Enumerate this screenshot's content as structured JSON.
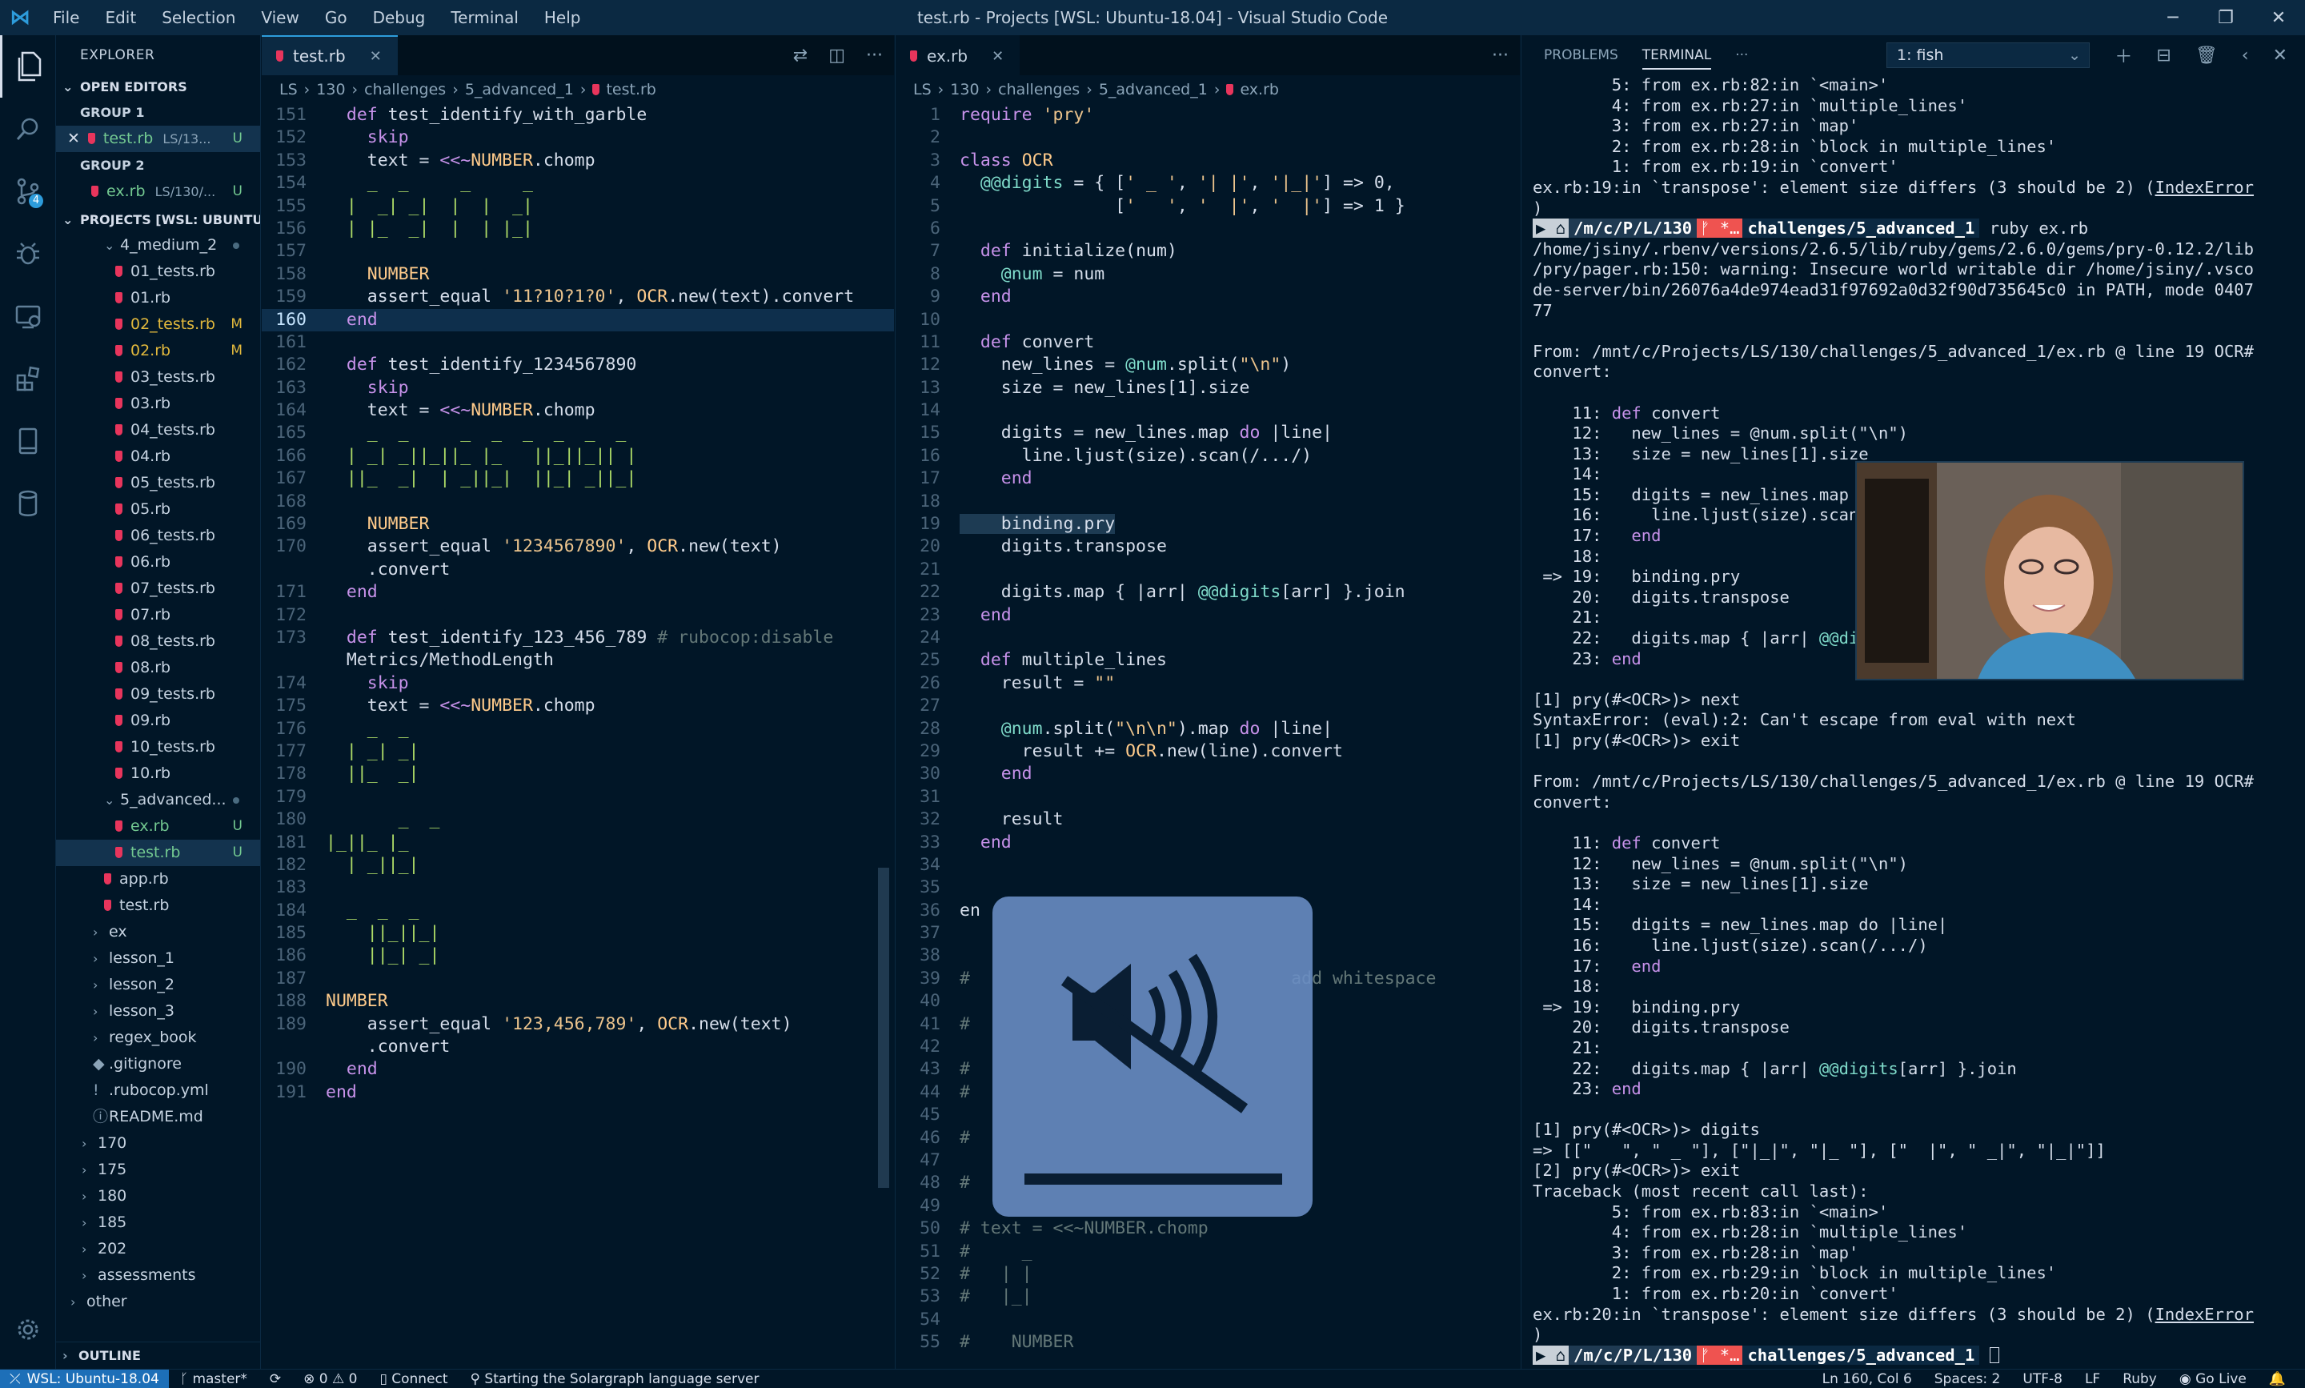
{
  "window": {
    "title": "test.rb - Projects [WSL: Ubuntu-18.04] - Visual Studio Code",
    "menu": [
      "File",
      "Edit",
      "Selection",
      "View",
      "Go",
      "Debug",
      "Terminal",
      "Help"
    ]
  },
  "activity": {
    "scm_badge": "4"
  },
  "sidebar": {
    "title": "EXPLORER",
    "open_editors_label": "OPEN EDITORS",
    "group1_label": "GROUP 1",
    "group1_file": "test.rb",
    "group1_path": "LS/13...",
    "group1_status": "U",
    "group2_label": "GROUP 2",
    "group2_file": "ex.rb",
    "group2_path": "LS/130/...",
    "group2_status": "U",
    "projects_label": "PROJECTS [WSL: UBUNTU-...",
    "tree": [
      {
        "name": "4_medium_2",
        "type": "folder-open",
        "indent": 2,
        "dot": true
      },
      {
        "name": "01_tests.rb",
        "type": "file",
        "indent": 3
      },
      {
        "name": "01.rb",
        "type": "file",
        "indent": 3
      },
      {
        "name": "02_tests.rb",
        "type": "file",
        "indent": 3,
        "status": "M"
      },
      {
        "name": "02.rb",
        "type": "file",
        "indent": 3,
        "status": "M"
      },
      {
        "name": "03_tests.rb",
        "type": "file",
        "indent": 3
      },
      {
        "name": "03.rb",
        "type": "file",
        "indent": 3
      },
      {
        "name": "04_tests.rb",
        "type": "file",
        "indent": 3
      },
      {
        "name": "04.rb",
        "type": "file",
        "indent": 3
      },
      {
        "name": "05_tests.rb",
        "type": "file",
        "indent": 3
      },
      {
        "name": "05.rb",
        "type": "file",
        "indent": 3
      },
      {
        "name": "06_tests.rb",
        "type": "file",
        "indent": 3
      },
      {
        "name": "06.rb",
        "type": "file",
        "indent": 3
      },
      {
        "name": "07_tests.rb",
        "type": "file",
        "indent": 3
      },
      {
        "name": "07.rb",
        "type": "file",
        "indent": 3
      },
      {
        "name": "08_tests.rb",
        "type": "file",
        "indent": 3
      },
      {
        "name": "08.rb",
        "type": "file",
        "indent": 3
      },
      {
        "name": "09_tests.rb",
        "type": "file",
        "indent": 3
      },
      {
        "name": "09.rb",
        "type": "file",
        "indent": 3
      },
      {
        "name": "10_tests.rb",
        "type": "file",
        "indent": 3
      },
      {
        "name": "10.rb",
        "type": "file",
        "indent": 3
      },
      {
        "name": "5_advanced...",
        "type": "folder-open",
        "indent": 2,
        "dot": true
      },
      {
        "name": "ex.rb",
        "type": "file",
        "indent": 3,
        "status": "U"
      },
      {
        "name": "test.rb",
        "type": "file",
        "indent": 3,
        "status": "U",
        "selected": true
      },
      {
        "name": "app.rb",
        "type": "file",
        "indent": 2
      },
      {
        "name": "test.rb",
        "type": "file",
        "indent": 2
      },
      {
        "name": "ex",
        "type": "folder",
        "indent": 1
      },
      {
        "name": "lesson_1",
        "type": "folder",
        "indent": 1
      },
      {
        "name": "lesson_2",
        "type": "folder",
        "indent": 1
      },
      {
        "name": "lesson_3",
        "type": "folder",
        "indent": 1
      },
      {
        "name": "regex_book",
        "type": "folder",
        "indent": 1
      },
      {
        "name": ".gitignore",
        "type": "plain",
        "indent": 1,
        "glyph": "◆"
      },
      {
        "name": ".rubocop.yml",
        "type": "plain",
        "indent": 1,
        "glyph": "!"
      },
      {
        "name": "README.md",
        "type": "plain",
        "indent": 1,
        "glyph": "ⓘ"
      },
      {
        "name": "170",
        "type": "folder",
        "indent": 0
      },
      {
        "name": "175",
        "type": "folder",
        "indent": 0
      },
      {
        "name": "180",
        "type": "folder",
        "indent": 0
      },
      {
        "name": "185",
        "type": "folder",
        "indent": 0
      },
      {
        "name": "202",
        "type": "folder",
        "indent": 0
      },
      {
        "name": "assessments",
        "type": "folder",
        "indent": 0
      },
      {
        "name": "other",
        "type": "folder",
        "indent": -1
      }
    ],
    "outline_label": "OUTLINE"
  },
  "editor1": {
    "tab": "test.rb",
    "breadcrumb": [
      "LS",
      "130",
      "challenges",
      "5_advanced_1",
      "test.rb"
    ],
    "lines": [
      {
        "n": "151",
        "t": "  def test_identify_with_garble"
      },
      {
        "n": "152",
        "t": "    skip"
      },
      {
        "n": "153",
        "t": "    text = <<~NUMBER.chomp"
      },
      {
        "n": "154",
        "t": "    _  _     _     _"
      },
      {
        "n": "155",
        "t": "  |  _| _|  |  |  _|"
      },
      {
        "n": "156",
        "t": "  | |_  _|  |  | |_|"
      },
      {
        "n": "157",
        "t": ""
      },
      {
        "n": "158",
        "t": "    NUMBER"
      },
      {
        "n": "159",
        "t": "    assert_equal '11?10?1?0', OCR.new(text).convert"
      },
      {
        "n": "160",
        "t": "  end"
      },
      {
        "n": "161",
        "t": ""
      },
      {
        "n": "162",
        "t": "  def test_identify_1234567890"
      },
      {
        "n": "163",
        "t": "    skip"
      },
      {
        "n": "164",
        "t": "    text = <<~NUMBER.chomp"
      },
      {
        "n": "165",
        "t": "    _  _     _  _  _  _  _  _"
      },
      {
        "n": "166",
        "t": "  | _| _||_||_ |_   ||_||_|| |"
      },
      {
        "n": "167",
        "t": "  ||_  _|  | _||_|  ||_| _||_|"
      },
      {
        "n": "168",
        "t": ""
      },
      {
        "n": "169",
        "t": "    NUMBER"
      },
      {
        "n": "170",
        "t": "    assert_equal '1234567890', OCR.new(text)"
      },
      {
        "n": "",
        "t": "    .convert"
      },
      {
        "n": "171",
        "t": "  end"
      },
      {
        "n": "172",
        "t": ""
      },
      {
        "n": "173",
        "t": "  def test_identify_123_456_789 # rubocop:disable"
      },
      {
        "n": "",
        "t": "  Metrics/MethodLength"
      },
      {
        "n": "174",
        "t": "    skip"
      },
      {
        "n": "175",
        "t": "    text = <<~NUMBER.chomp"
      },
      {
        "n": "176",
        "t": "    _  _"
      },
      {
        "n": "177",
        "t": "  | _| _|"
      },
      {
        "n": "178",
        "t": "  ||_  _|"
      },
      {
        "n": "179",
        "t": ""
      },
      {
        "n": "180",
        "t": "       _  _"
      },
      {
        "n": "181",
        "t": "|_||_ |_"
      },
      {
        "n": "182",
        "t": "  | _||_|"
      },
      {
        "n": "183",
        "t": ""
      },
      {
        "n": "184",
        "t": "  _  _  _"
      },
      {
        "n": "185",
        "t": "    ||_||_|"
      },
      {
        "n": "186",
        "t": "    ||_| _|"
      },
      {
        "n": "187",
        "t": ""
      },
      {
        "n": "188",
        "t": "NUMBER"
      },
      {
        "n": "189",
        "t": "    assert_equal '123,456,789', OCR.new(text)"
      },
      {
        "n": "",
        "t": "    .convert"
      },
      {
        "n": "190",
        "t": "  end"
      },
      {
        "n": "191",
        "t": "end"
      }
    ]
  },
  "editor2": {
    "tab": "ex.rb",
    "breadcrumb": [
      "LS",
      "130",
      "challenges",
      "5_advanced_1",
      "ex.rb"
    ],
    "lines": [
      {
        "n": "1",
        "t": "require 'pry'"
      },
      {
        "n": "2",
        "t": ""
      },
      {
        "n": "3",
        "t": "class OCR"
      },
      {
        "n": "4",
        "t": "  @@digits = { [' _ ', '| |', '|_|'] => 0,"
      },
      {
        "n": "5",
        "t": "               ['   ', '  |', '  |'] => 1 }"
      },
      {
        "n": "6",
        "t": ""
      },
      {
        "n": "7",
        "t": "  def initialize(num)"
      },
      {
        "n": "8",
        "t": "    @num = num"
      },
      {
        "n": "9",
        "t": "  end"
      },
      {
        "n": "10",
        "t": ""
      },
      {
        "n": "11",
        "t": "  def convert"
      },
      {
        "n": "12",
        "t": "    new_lines = @num.split(\"\\n\")"
      },
      {
        "n": "13",
        "t": "    size = new_lines[1].size"
      },
      {
        "n": "14",
        "t": ""
      },
      {
        "n": "15",
        "t": "    digits = new_lines.map do |line|"
      },
      {
        "n": "16",
        "t": "      line.ljust(size).scan(/.../)"
      },
      {
        "n": "17",
        "t": "    end"
      },
      {
        "n": "18",
        "t": ""
      },
      {
        "n": "19",
        "t": "    binding.pry"
      },
      {
        "n": "20",
        "t": "    digits.transpose"
      },
      {
        "n": "21",
        "t": ""
      },
      {
        "n": "22",
        "t": "    digits.map { |arr| @@digits[arr] }.join"
      },
      {
        "n": "23",
        "t": "  end"
      },
      {
        "n": "24",
        "t": ""
      },
      {
        "n": "25",
        "t": "  def multiple_lines"
      },
      {
        "n": "26",
        "t": "    result = \"\""
      },
      {
        "n": "27",
        "t": ""
      },
      {
        "n": "28",
        "t": "    @num.split(\"\\n\\n\").map do |line|"
      },
      {
        "n": "29",
        "t": "      result += OCR.new(line).convert"
      },
      {
        "n": "30",
        "t": "    end"
      },
      {
        "n": "31",
        "t": ""
      },
      {
        "n": "32",
        "t": "    result"
      },
      {
        "n": "33",
        "t": "  end"
      },
      {
        "n": "34",
        "t": ""
      },
      {
        "n": "35",
        "t": ""
      },
      {
        "n": "36",
        "t": "en"
      },
      {
        "n": "37",
        "t": ""
      },
      {
        "n": "38",
        "t": ""
      },
      {
        "n": "39",
        "t": "#                               add whitespace"
      },
      {
        "n": "40",
        "t": ""
      },
      {
        "n": "41",
        "t": "#"
      },
      {
        "n": "42",
        "t": ""
      },
      {
        "n": "43",
        "t": "#"
      },
      {
        "n": "44",
        "t": "#"
      },
      {
        "n": "45",
        "t": ""
      },
      {
        "n": "46",
        "t": "#"
      },
      {
        "n": "47",
        "t": ""
      },
      {
        "n": "48",
        "t": "#"
      },
      {
        "n": "49",
        "t": ""
      },
      {
        "n": "50",
        "t": "# text = <<~NUMBER.chomp"
      },
      {
        "n": "51",
        "t": "#     _"
      },
      {
        "n": "52",
        "t": "#   | |"
      },
      {
        "n": "53",
        "t": "#   |_|"
      },
      {
        "n": "54",
        "t": ""
      },
      {
        "n": "55",
        "t": "#    NUMBER"
      }
    ]
  },
  "terminal": {
    "tabs": [
      "PROBLEMS",
      "TERMINAL"
    ],
    "active_tab": "TERMINAL",
    "more": "···",
    "shell_select": "1: fish",
    "lines": [
      "        5: from ex.rb:82:in `<main>'",
      "        4: from ex.rb:27:in `multiple_lines'",
      "        3: from ex.rb:27:in `map'",
      "        2: from ex.rb:28:in `block in multiple_lines'",
      "        1: from ex.rb:19:in `convert'",
      "ex.rb:19:in `transpose': element size differs (3 should be 2) (IndexError",
      ")",
      "PROMPT1",
      "/home/jsiny/.rbenv/versions/2.6.5/lib/ruby/gems/2.6.0/gems/pry-0.12.2/lib",
      "/pry/pager.rb:150: warning: Insecure world writable dir /home/jsiny/.vsco",
      "de-server/bin/26076a4de974ead31f97692a0d32f90d735645c0 in PATH, mode 0407",
      "77",
      "",
      "From: /mnt/c/Projects/LS/130/challenges/5_advanced_1/ex.rb @ line 19 OCR#",
      "convert:",
      "",
      "    11: def convert",
      "    12:   new_lines = @num.split(\"\\n\")",
      "    13:   size = new_lines[1].size",
      "    14:",
      "    15:   digits = new_lines.map do |line|",
      "    16:     line.ljust(size).scan(/.../)",
      "    17:   end",
      "    18:",
      " => 19:   binding.pry",
      "    20:   digits.transpose",
      "    21:",
      "    22:   digits.map { |arr| @@digits[arr] }.join",
      "    23: end",
      "",
      "[1] pry(#<OCR>)> next",
      "SyntaxError: (eval):2: Can't escape from eval with next",
      "[1] pry(#<OCR>)> exit",
      "",
      "From: /mnt/c/Projects/LS/130/challenges/5_advanced_1/ex.rb @ line 19 OCR#",
      "convert:",
      "",
      "    11: def convert",
      "    12:   new_lines = @num.split(\"\\n\")",
      "    13:   size = new_lines[1].size",
      "    14:",
      "    15:   digits = new_lines.map do |line|",
      "    16:     line.ljust(size).scan(/.../)",
      "    17:   end",
      "    18:",
      " => 19:   binding.pry",
      "    20:   digits.transpose",
      "    21:",
      "    22:   digits.map { |arr| @@digits[arr] }.join",
      "    23: end",
      "",
      "[1] pry(#<OCR>)> digits",
      "=> [[\"   \", \" _ \"], [\"|_|\", \"|_ \"], [\"  |\", \" _|\", \"|_|\"]]",
      "[2] pry(#<OCR>)> exit",
      "Traceback (most recent call last):",
      "        5: from ex.rb:83:in `<main>'",
      "        4: from ex.rb:28:in `multiple_lines'",
      "        3: from ex.rb:28:in `map'",
      "        2: from ex.rb:29:in `block in multiple_lines'",
      "        1: from ex.rb:20:in `convert'",
      "ex.rb:20:in `transpose': element size differs (3 should be 2) (IndexError",
      ")",
      "PROMPT2"
    ],
    "prompt": {
      "path": "/m/c/P/L/130",
      "branch": "ᚠ *…",
      "dir": "challenges/5_advanced_1",
      "cmd1": "ruby ex.rb"
    }
  },
  "statusbar": {
    "remote": "WSL: Ubuntu-18.04",
    "branch": "master*",
    "problems": "⊗ 0 ⚠ 0",
    "connect": "Connect",
    "message": "Starting the Solargraph language server",
    "position": "Ln 160, Col 6",
    "spaces": "Spaces: 2",
    "encoding": "UTF-8",
    "eol": "LF",
    "language": "Ruby",
    "golive": "Go Live"
  },
  "colors": {
    "bg": "#011627",
    "accent": "#2d9cdb",
    "ruby_icon": "#e8355c",
    "modified": "#e2b93d",
    "untracked": "#73c991"
  }
}
